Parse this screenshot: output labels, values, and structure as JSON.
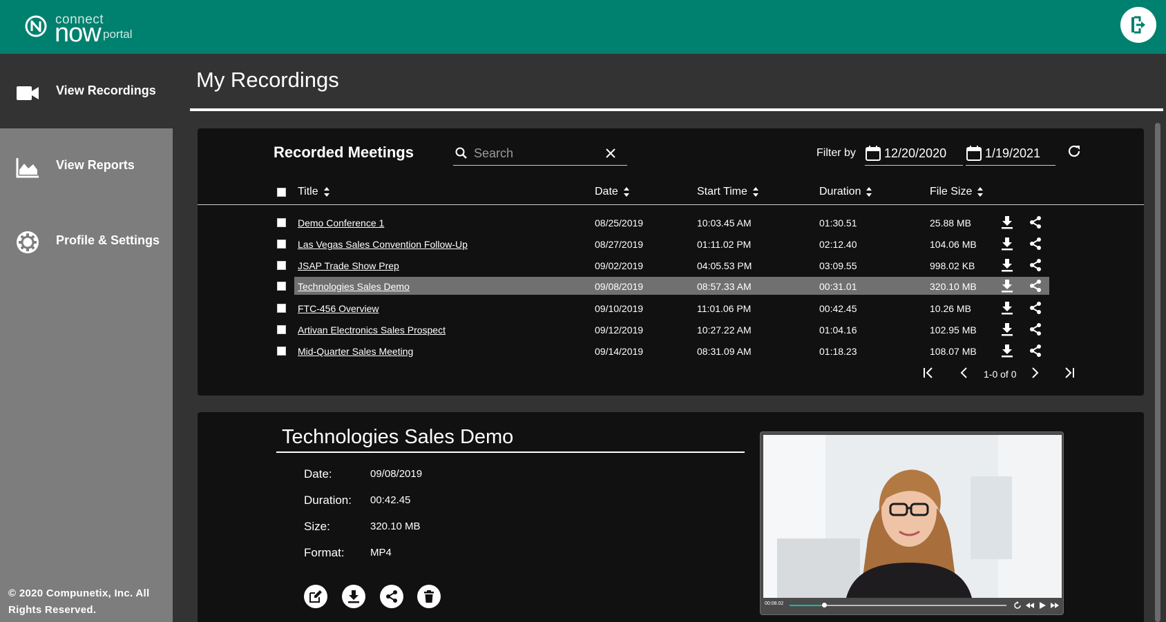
{
  "brand": {
    "line1": "connect",
    "line2": "now",
    "line3": "portal"
  },
  "sidebar": {
    "items": [
      {
        "label": "View Recordings",
        "icon": "video-camera-icon",
        "active": true
      },
      {
        "label": "View Reports",
        "icon": "chart-icon",
        "active": false
      },
      {
        "label": "Profile & Settings",
        "icon": "gear-icon",
        "active": false
      }
    ],
    "copyright": "© 2020 Compunetix, Inc. All Rights Reserved."
  },
  "page": {
    "title": "My Recordings"
  },
  "recordings": {
    "section_title": "Recorded Meetings",
    "search_placeholder": "Search",
    "filter_label": "Filter by",
    "date_from": "12/20/2020",
    "date_to": "1/19/2021",
    "columns": [
      "Title",
      "Date",
      "Start Time",
      "Duration",
      "File Size"
    ],
    "rows": [
      {
        "title": "Demo Conference 1",
        "date": "08/25/2019",
        "start": "10:03.45 AM",
        "duration": "01:30.51",
        "size": "25.88 MB"
      },
      {
        "title": "Las Vegas Sales Convention Follow-Up",
        "date": "08/27/2019",
        "start": "01:11.02 PM",
        "duration": "02:12.40",
        "size": "104.06 MB"
      },
      {
        "title": "JSAP Trade Show Prep",
        "date": "09/02/2019",
        "start": "04:05.53 PM",
        "duration": "03:09.55",
        "size": "998.02 KB"
      },
      {
        "title": "Technologies Sales Demo",
        "date": "09/08/2019",
        "start": "08:57.33 AM",
        "duration": "00:31.01",
        "size": "320.10 MB",
        "selected": true
      },
      {
        "title": "FTC-456 Overview",
        "date": "09/10/2019",
        "start": "11:01.06 PM",
        "duration": "00:42.45",
        "size": "10.26 MB"
      },
      {
        "title": "Artivan Electronics Sales Prospect",
        "date": "09/12/2019",
        "start": "10:27.22 AM",
        "duration": "01:04.16",
        "size": "102.95 MB"
      },
      {
        "title": "Mid-Quarter Sales Meeting",
        "date": "09/14/2019",
        "start": "08:31.09 AM",
        "duration": "01:18.23",
        "size": "108.07 MB"
      }
    ],
    "pagination": "1-0 of 0"
  },
  "detail": {
    "title": "Technologies Sales Demo",
    "fields": [
      {
        "label": "Date:",
        "value": "09/08/2019"
      },
      {
        "label": "Duration:",
        "value": "00:42.45"
      },
      {
        "label": "Size:",
        "value": "320.10 MB"
      },
      {
        "label": "Format:",
        "value": "MP4"
      }
    ],
    "player": {
      "time": "00:08.02",
      "progress": 0.16
    }
  },
  "colors": {
    "header": "#00806f",
    "sidebar": "#7d7d7d",
    "panel": "#111111",
    "background": "#333333",
    "selected_row": "#707070"
  }
}
